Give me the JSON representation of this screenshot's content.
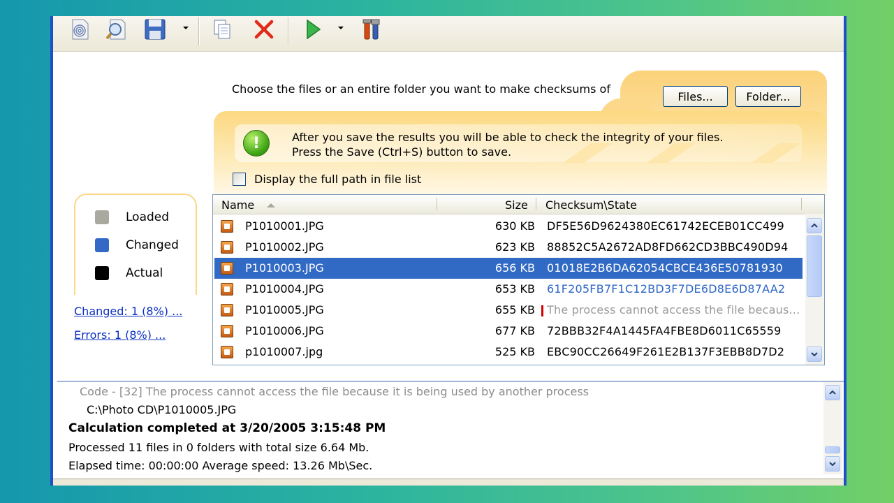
{
  "toolbar": {
    "icons": [
      "open-fingerprint-icon",
      "verify-magnifier-icon",
      "save-floppy-icon",
      "copy-icon",
      "delete-icon",
      "run-icon",
      "tools-icon"
    ]
  },
  "header": {
    "instruction": "Choose the files or an entire folder you want to make checksums of",
    "files_button": "Files...",
    "folder_button": "Folder..."
  },
  "info": {
    "line1": "After you save the results you will be able to check the integrity of your files.",
    "line2": "Press the Save (Ctrl+S) button to save."
  },
  "options": {
    "full_path_label": "Display the full path in file list",
    "full_path_checked": false
  },
  "legend": {
    "items": [
      {
        "label": "Loaded",
        "color": "#a9a9a0"
      },
      {
        "label": "Changed",
        "color": "#3569c6"
      },
      {
        "label": "Actual",
        "color": "#000000"
      }
    ],
    "changed_link": "Changed: 1 (8%) ...",
    "errors_link": "Errors: 1 (8%) ..."
  },
  "file_list": {
    "columns": [
      "Name",
      "Size",
      "Checksum\\State"
    ],
    "rows": [
      {
        "name": "P1010001.JPG",
        "size": "630 KB",
        "checksum": "DF5E56D9624380EC61742ECEB01CC499",
        "state": "normal"
      },
      {
        "name": "P1010002.JPG",
        "size": "623 KB",
        "checksum": "88852C5A2672AD8FD662CD3BBC490D94",
        "state": "normal"
      },
      {
        "name": "P1010003.JPG",
        "size": "656 KB",
        "checksum": "01018E2B6DA62054CBCE436E50781930",
        "state": "selected"
      },
      {
        "name": "P1010004.JPG",
        "size": "653 KB",
        "checksum": "61F205FB7F1C12BD3F7DE6D8E6D87AA2",
        "state": "changed"
      },
      {
        "name": "P1010005.JPG",
        "size": "655 KB",
        "checksum": "The process cannot access the file becaus...",
        "state": "error"
      },
      {
        "name": "P1010006.JPG",
        "size": "677 KB",
        "checksum": "72BBB32F4A1445FA4FBE8D6011C65559",
        "state": "normal"
      },
      {
        "name": "p1010007.jpg",
        "size": "525 KB",
        "checksum": "EBC90CC26649F261E2B137F3EBB8D7D2",
        "state": "normal"
      }
    ]
  },
  "log": {
    "error_code": "Code - [32] The process cannot access the file because it is being used by another process",
    "error_path": "C:\\Photo CD\\P1010005.JPG",
    "completed": "Calculation completed at 3/20/2005 3:15:48 PM",
    "processed": "Processed 11 files in 0 folders with total size 6.64 Mb.",
    "elapsed": "Elapsed time: 00:00:00 Average speed: 13.26 Mb\\Sec."
  }
}
